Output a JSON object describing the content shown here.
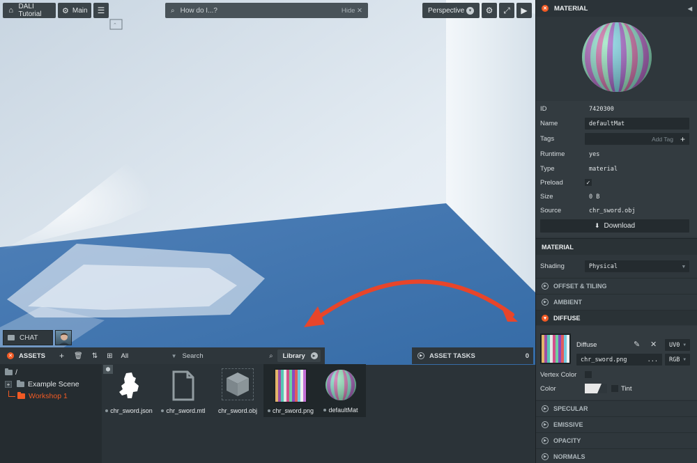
{
  "toolbar": {
    "project": "DALI Tutorial",
    "scene": "Main",
    "search_placeholder": "How do I...?",
    "hide_label": "Hide",
    "camera": "Perspective"
  },
  "chat": {
    "label": "CHAT"
  },
  "assets": {
    "title": "ASSETS",
    "filter": "All",
    "search_placeholder": "Search",
    "library_label": "Library",
    "tree": [
      {
        "label": "/"
      },
      {
        "label": "Example Scene"
      },
      {
        "label": "Workshop 1"
      }
    ],
    "files": [
      {
        "name": "chr_sword.json",
        "icon": "model-json-icon"
      },
      {
        "name": "chr_sword.mtl",
        "icon": "file-icon"
      },
      {
        "name": "chr_sword.obj",
        "icon": "cube-icon"
      },
      {
        "name": "chr_sword.png",
        "icon": "texture-icon"
      },
      {
        "name": "defaultMat",
        "icon": "material-sphere-icon"
      }
    ]
  },
  "asset_tasks": {
    "title": "ASSET TASKS",
    "count": "0"
  },
  "inspector": {
    "title": "MATERIAL",
    "props": {
      "id_label": "ID",
      "id": "7420300",
      "name_label": "Name",
      "name": "defaultMat",
      "tags_label": "Tags",
      "tags_placeholder": "Add Tag",
      "runtime_label": "Runtime",
      "runtime": "yes",
      "type_label": "Type",
      "type": "material",
      "preload_label": "Preload",
      "size_label": "Size",
      "size": "0 B",
      "source_label": "Source",
      "source": "chr_sword.obj",
      "download": "Download"
    },
    "material_title": "MATERIAL",
    "shading_label": "Shading",
    "shading": "Physical",
    "sections": {
      "offset": "OFFSET & TILING",
      "ambient": "AMBIENT",
      "diffuse": "DIFFUSE",
      "specular": "SPECULAR",
      "emissive": "EMISSIVE",
      "opacity": "OPACITY",
      "normals": "NORMALS"
    },
    "diffuse": {
      "label": "Diffuse",
      "map": "chr_sword.png",
      "more": "...",
      "uv": "UV0",
      "channel": "RGB",
      "vertex_color": "Vertex Color",
      "color_label": "Color",
      "tint": "Tint"
    }
  },
  "colors": {
    "accent": "#f15a24",
    "floor": "#3f74ad",
    "arrow": "#e8452a"
  }
}
